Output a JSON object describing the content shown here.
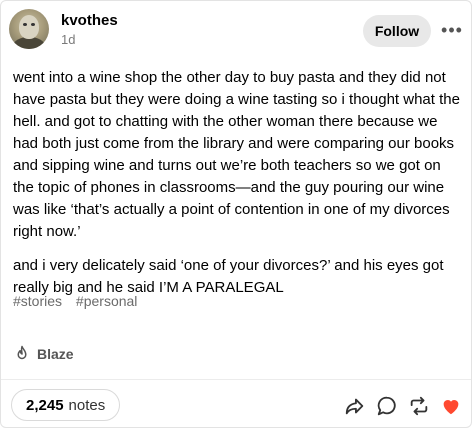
{
  "post": {
    "username": "kvothes",
    "timestamp": "1d",
    "follow_label": "Follow",
    "more_label": "•••",
    "paragraphs": [
      "went into a wine shop the other day to buy pasta and they did not have pasta but they were doing a wine tasting so i thought what the hell. and got to chatting with the other woman there because we had both just come from the library and were comparing our books and sipping wine and turns out we’re both teachers so we got on the topic of phones in classrooms—and the guy pouring our wine was like ‘that’s actually a point of contention in one of my divorces right now.’",
      "and i very delicately said ‘one of your divorces?’ and his eyes got really big and he said I’M A PARALEGAL"
    ],
    "tags": [
      "#stories",
      "#personal"
    ],
    "blaze_label": "Blaze"
  },
  "footer": {
    "notes_count": "2,245",
    "notes_label": "notes",
    "icons": [
      "share-icon",
      "reply-icon",
      "reblog-icon",
      "like-icon"
    ],
    "like_color": "#ff4930",
    "icon_color": "#333333"
  }
}
